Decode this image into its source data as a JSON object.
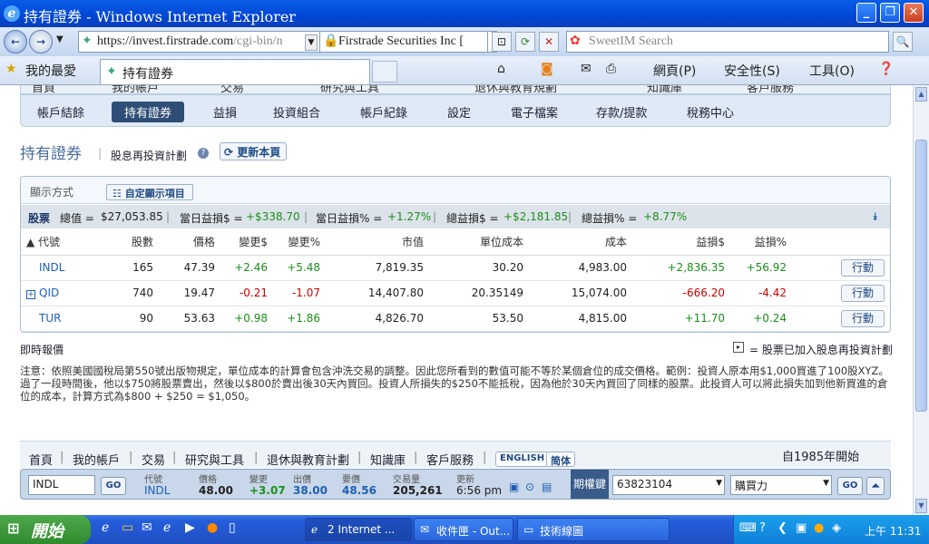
{
  "window": {
    "title": "持有證券 - Windows Internet Explorer"
  },
  "browser": {
    "url_scheme": "https://invest.",
    "url_host": "firstrade.com",
    "url_path": "/cgi-bin/n",
    "site_name": "Firstrade Securities Inc [",
    "search_placeholder": "SweetIM Search",
    "favorites_label": "我的最愛",
    "tab_title": "持有證券",
    "menu": {
      "page": "網頁(P)",
      "safety": "安全性(S)",
      "tools": "工具(O)"
    }
  },
  "topnav": [
    "首頁",
    "我的帳戶",
    "交易",
    "研究與工具",
    "退休與教育規劃",
    "知識庫",
    "客戶服務"
  ],
  "subnav": [
    "帳戶結餘",
    "持有證券",
    "益損",
    "投資組合",
    "帳戶紀錄",
    "設定",
    "電子檔案",
    "存款/提款",
    "稅務中心"
  ],
  "page": {
    "title": "持有證券",
    "drip_link": "股息再投資計劃",
    "refresh_label": "更新本頁",
    "display_mode": "顯示方式",
    "customize_label": "自定顯示項目"
  },
  "summary": {
    "label": "股票",
    "total_value_label": "總值 =",
    "total_value": "$27,053.85",
    "day_gain_label": "當日益損$ =",
    "day_gain": "+$338.70",
    "day_gain_pct_label": "當日益損% =",
    "day_gain_pct": "+1.27%",
    "total_gain_label": "總益損$ =",
    "total_gain": "+$2,181.85",
    "total_gain_pct_label": "總益損% =",
    "total_gain_pct": "+8.77%"
  },
  "table": {
    "headers": [
      "▲ 代號",
      "股數",
      "價格",
      "變更$",
      "變更%",
      "市值",
      "單位成本",
      "成本",
      "益損$",
      "益損%"
    ],
    "rows": [
      {
        "symbol": "INDL",
        "shares": "165",
        "price": "47.39",
        "chg": "+2.46",
        "chg_pct": "+5.48",
        "value": "7,819.35",
        "unit_cost": "30.20",
        "cost": "4,983.00",
        "gain": "+2,836.35",
        "gain_pct": "+56.92",
        "action": "行動",
        "drip": false
      },
      {
        "symbol": "QID",
        "shares": "740",
        "price": "19.47",
        "chg": "-0.21",
        "chg_pct": "-1.07",
        "value": "14,407.80",
        "unit_cost": "20.35149",
        "cost": "15,074.00",
        "gain": "-666.20",
        "gain_pct": "-4.42",
        "action": "行動",
        "drip": true
      },
      {
        "symbol": "TUR",
        "shares": "90",
        "price": "53.63",
        "chg": "+0.98",
        "chg_pct": "+1.86",
        "value": "4,826.70",
        "unit_cost": "53.50",
        "cost": "4,815.00",
        "gain": "+11.70",
        "gain_pct": "+0.24",
        "action": "行動",
        "drip": false
      }
    ]
  },
  "realtime_label": "即時報價",
  "drip_legend": "= 股票已加入股息再投資計劃",
  "note": "注意：依照美國國稅局第550號出版物規定，單位成本的計算會包含沖洗交易的調整。因此您所看到的數值可能不等於某個倉位的成交價格。範例：投資人原本用$1,000買進了100股XYZ。過了一段時間後，他以$750將股票賣出，然後以$800於賣出後30天內買回。投資人所損失的$250不能抵稅，因為他於30天內買回了同樣的股票。此投資人可以將此損失加到他新買進的倉位的成本，計算方式為$800 + $250 = $1,050。",
  "footer": {
    "links": [
      "首頁",
      "我的帳戶",
      "交易",
      "研究與工具",
      "退休與教育計劃",
      "知識庫",
      "客戶服務"
    ],
    "english": "ENGLISH",
    "simplified": "简体",
    "since": "自1985年開始"
  },
  "quote": {
    "symbol_input": "INDL",
    "go": "GO",
    "cols": [
      "代號",
      "價格",
      "變更",
      "出價",
      "要價",
      "交易量",
      "更新"
    ],
    "symbol": "INDL",
    "price": "48.00",
    "change": "+3.07",
    "bid": "38.00",
    "ask": "48.56",
    "volume": "205,261",
    "updated": "6:56 pm",
    "options_label": "期權鍵",
    "account": "63823104",
    "buying_power": "購買力"
  },
  "taskbar": {
    "start": "開始",
    "tasks": [
      "2 Internet ...",
      "收件匣 - Out...",
      "技術線圖"
    ],
    "clock": "上午 11:31"
  }
}
